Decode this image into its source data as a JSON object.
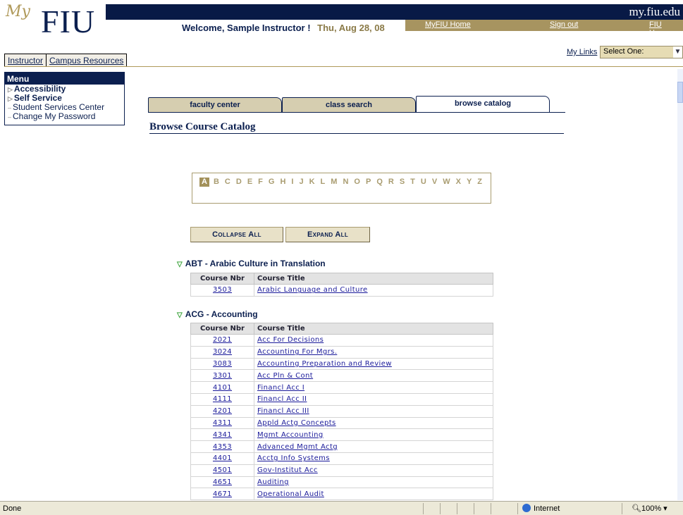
{
  "header": {
    "logo_my": "My",
    "logo_fiu": "FIU",
    "site": "my.fiu.edu",
    "welcome": "Welcome, Sample Instructor !",
    "date": "Thu, Aug 28, 08",
    "links": [
      "MyFIU Home",
      "Sign out",
      "FIU Home"
    ]
  },
  "top_tabs": [
    "Instructor",
    "Campus Resources"
  ],
  "my_links": {
    "label": "My Links",
    "select_value": "Select One:"
  },
  "menu": {
    "title": "Menu",
    "items": [
      "Accessibility",
      "Self Service",
      "Student Services Center",
      "Change My Password"
    ]
  },
  "content_tabs": [
    "faculty center",
    "class search",
    "browse catalog"
  ],
  "page_title": "Browse Course Catalog",
  "alphabet": [
    "A",
    "B",
    "C",
    "D",
    "E",
    "F",
    "G",
    "H",
    "I",
    "J",
    "K",
    "L",
    "M",
    "N",
    "O",
    "P",
    "Q",
    "R",
    "S",
    "T",
    "U",
    "V",
    "W",
    "X",
    "Y",
    "Z"
  ],
  "buttons": {
    "collapse": "Collapse All",
    "expand": "Expand All"
  },
  "table_headers": {
    "nbr": "Course Nbr",
    "title": "Course Title"
  },
  "subjects": [
    {
      "title": "ABT - Arabic Culture in Translation",
      "courses": [
        {
          "nbr": "3503",
          "title": "Arabic Language and Culture"
        }
      ]
    },
    {
      "title": "ACG - Accounting",
      "courses": [
        {
          "nbr": "2021",
          "title": "Acc For Decisions"
        },
        {
          "nbr": "3024",
          "title": "Accounting For Mgrs."
        },
        {
          "nbr": "3083",
          "title": "Accounting Preparation and Review"
        },
        {
          "nbr": "3301",
          "title": "Acc Pln & Cont"
        },
        {
          "nbr": "4101",
          "title": "Financl Acc I"
        },
        {
          "nbr": "4111",
          "title": "Financl Acc II"
        },
        {
          "nbr": "4201",
          "title": "Financl Acc III"
        },
        {
          "nbr": "4311",
          "title": "Appld Actg Concepts"
        },
        {
          "nbr": "4341",
          "title": "Mgmt Accounting"
        },
        {
          "nbr": "4353",
          "title": "Advanced Mgmt Actg"
        },
        {
          "nbr": "4401",
          "title": "Acctg Info Systems"
        },
        {
          "nbr": "4501",
          "title": "Gov-Institut Acc"
        },
        {
          "nbr": "4651",
          "title": "Auditing"
        },
        {
          "nbr": "4671",
          "title": "Operational Audit"
        }
      ]
    }
  ],
  "status": {
    "left": "Done",
    "zone": "Internet",
    "zoom": "100%"
  }
}
